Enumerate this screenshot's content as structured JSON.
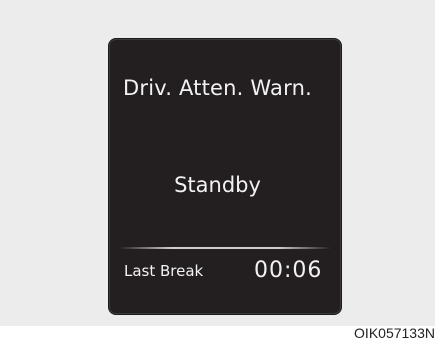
{
  "display": {
    "title": "Driv. Atten. Warn.",
    "status": "Standby",
    "last_break_label": "Last Break",
    "last_break_time": "00:06"
  },
  "caption": {
    "code": "OIK057133N"
  },
  "colors": {
    "background": "#ececec",
    "display_bg": "#231f20",
    "text": "#f2f2f2"
  }
}
